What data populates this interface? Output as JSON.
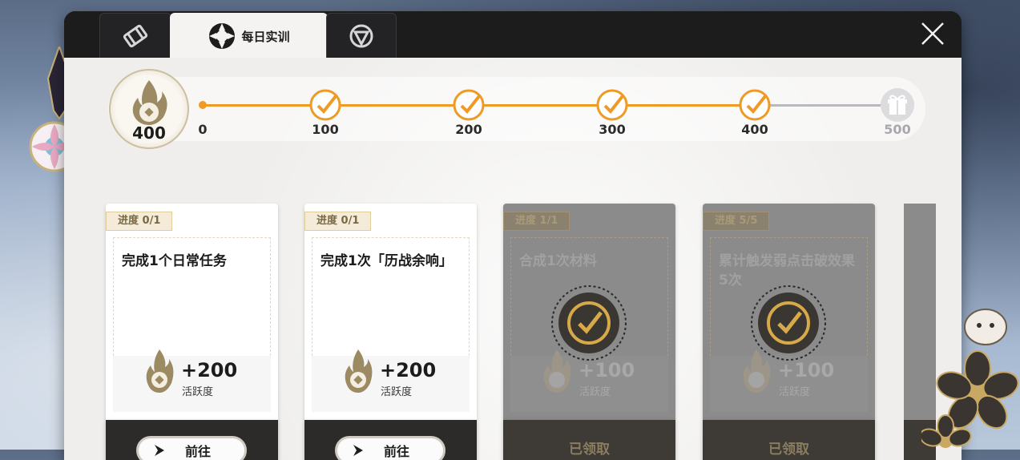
{
  "tabs": [
    {
      "icon": "scroll-icon",
      "label": ""
    },
    {
      "icon": "emblem-icon",
      "label": "每日实训"
    },
    {
      "icon": "shield-icon",
      "label": ""
    }
  ],
  "progress": {
    "current": "400",
    "start_label": "0",
    "milestones": [
      "100",
      "200",
      "300",
      "400"
    ],
    "final_label": "500",
    "accent_color": "#f09a26"
  },
  "tasks": [
    {
      "progress": "进度 0/1",
      "title": "完成1个日常任务",
      "reward": "+200",
      "reward_unit": "活跃度",
      "action": "前往",
      "status": "pending"
    },
    {
      "progress": "进度 0/1",
      "title": "完成1次「历战余响」",
      "reward": "+200",
      "reward_unit": "活跃度",
      "action": "前往",
      "status": "pending"
    },
    {
      "progress": "进度 1/1",
      "title": "合成1次材料",
      "reward": "+100",
      "reward_unit": "活跃度",
      "action": "已领取",
      "status": "claimed"
    },
    {
      "progress": "进度 5/5",
      "title": "累计触发弱点击破效果5次",
      "reward": "+100",
      "reward_unit": "活跃度",
      "action": "已领取",
      "status": "claimed"
    }
  ]
}
